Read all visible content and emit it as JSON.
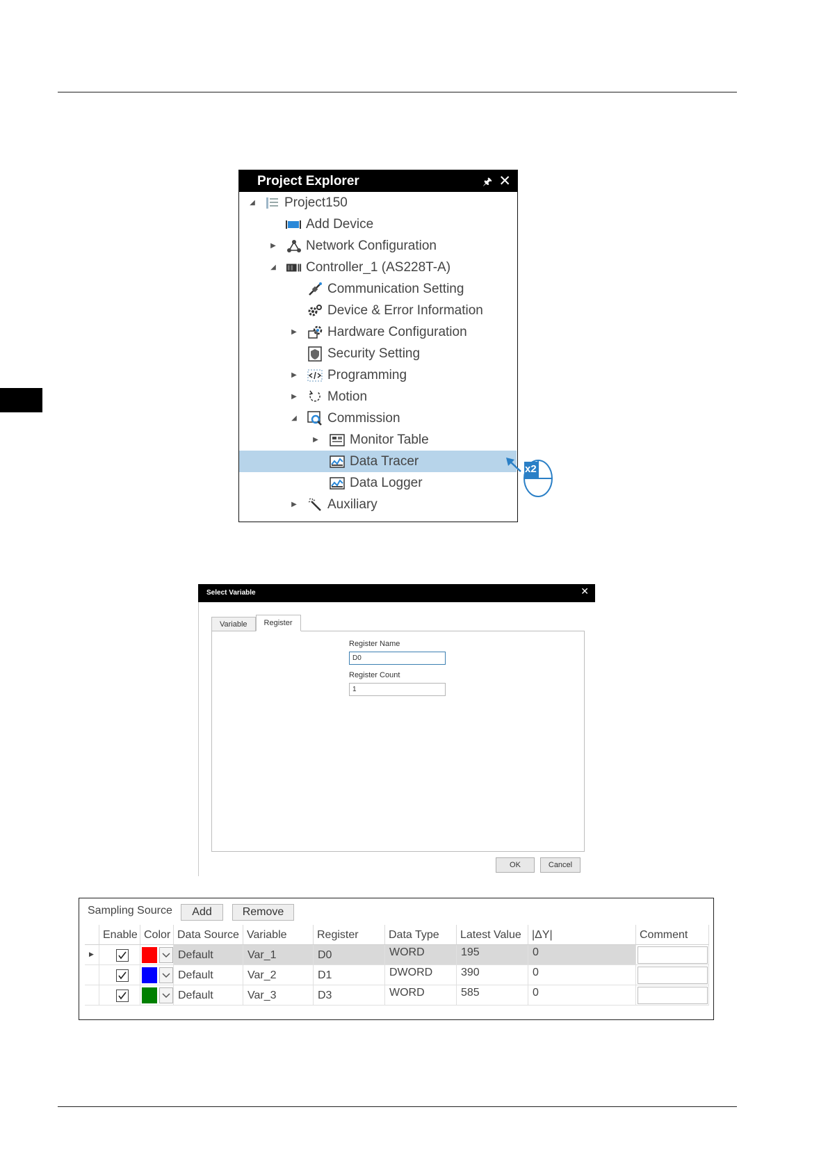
{
  "project_explorer": {
    "title": "Project Explorer",
    "items": [
      {
        "label": "Project150",
        "icon": "project-icon"
      },
      {
        "label": "Add Device",
        "icon": "add-device-icon"
      },
      {
        "label": "Network Configuration",
        "icon": "network-icon"
      },
      {
        "label": "Controller_1 (AS228T-A)",
        "icon": "controller-icon"
      },
      {
        "label": "Communication Setting",
        "icon": "communication-icon"
      },
      {
        "label": "Device & Error Information",
        "icon": "device-error-icon"
      },
      {
        "label": "Hardware Configuration",
        "icon": "hardware-icon"
      },
      {
        "label": "Security Setting",
        "icon": "security-icon"
      },
      {
        "label": "Programming",
        "icon": "programming-icon"
      },
      {
        "label": "Motion",
        "icon": "motion-icon"
      },
      {
        "label": "Commission",
        "icon": "commission-icon"
      },
      {
        "label": "Monitor Table",
        "icon": "monitor-table-icon"
      },
      {
        "label": "Data Tracer",
        "icon": "data-tracer-icon"
      },
      {
        "label": "Data Logger",
        "icon": "data-logger-icon"
      },
      {
        "label": "Auxiliary",
        "icon": "auxiliary-icon"
      }
    ],
    "selected": "Data Tracer"
  },
  "annotation": {
    "double_click_badge": "x2"
  },
  "select_variable": {
    "title": "Select Variable",
    "tabs": [
      "Variable",
      "Register"
    ],
    "active_tab": "Register",
    "register_name_label": "Register Name",
    "register_name_value": "D0",
    "register_count_label": "Register Count",
    "register_count_value": "1",
    "ok_label": "OK",
    "cancel_label": "Cancel"
  },
  "sampling": {
    "source_label": "Sampling Source",
    "add_label": "Add",
    "remove_label": "Remove",
    "columns": [
      "Enable",
      "Color",
      "Data Source",
      "Variable",
      "Register",
      "Data Type",
      "Latest Value",
      "|ΔY|",
      "Comment"
    ],
    "rows": [
      {
        "enabled": true,
        "color": "#ff0000",
        "data_source": "Default",
        "variable": "Var_1",
        "register": "D0",
        "data_type": "WORD",
        "latest_value": "195",
        "delta_y": "0",
        "comment": ""
      },
      {
        "enabled": true,
        "color": "#0000ff",
        "data_source": "Default",
        "variable": "Var_2",
        "register": "D1",
        "data_type": "DWORD",
        "latest_value": "390",
        "delta_y": "0",
        "comment": ""
      },
      {
        "enabled": true,
        "color": "#008000",
        "data_source": "Default",
        "variable": "Var_3",
        "register": "D3",
        "data_type": "WORD",
        "latest_value": "585",
        "delta_y": "0",
        "comment": ""
      }
    ]
  }
}
